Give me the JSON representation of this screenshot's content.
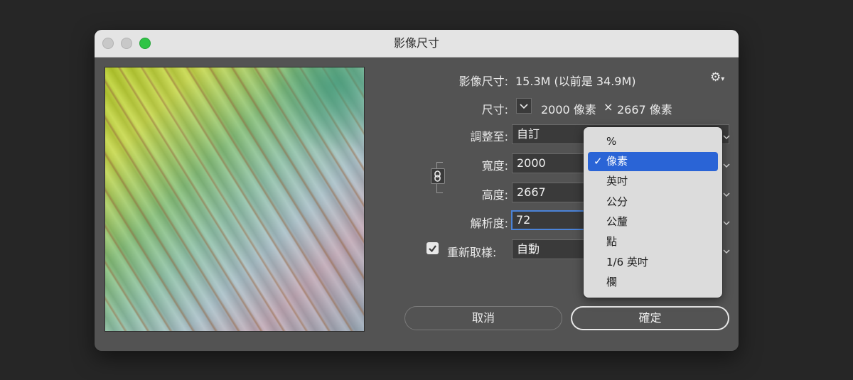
{
  "window": {
    "title": "影像尺寸"
  },
  "info": {
    "image_size_label": "影像尺寸:",
    "image_size_value": "15.3M (以前是 34.9M)",
    "dimensions_label": "尺寸:",
    "width_px": "2000 像素",
    "times": "×",
    "height_px": "2667 像素"
  },
  "form": {
    "fit_to_label": "調整至:",
    "fit_to_value": "自訂",
    "width_label": "寬度:",
    "width_value": "2000",
    "height_label": "高度:",
    "height_value": "2667",
    "resolution_label": "解析度:",
    "resolution_value": "72",
    "resample_label": "重新取樣:",
    "resample_value": "自動",
    "resample_checked": true
  },
  "unit_menu": {
    "items": [
      "%",
      "像素",
      "英吋",
      "公分",
      "公釐",
      "點",
      "1/6 英吋",
      "欄"
    ],
    "selected": "像素"
  },
  "buttons": {
    "cancel": "取消",
    "ok": "確定"
  },
  "colors": {
    "accent": "#2a64d6",
    "focus": "#4b83d8",
    "zoom_button": "#2fc445"
  }
}
